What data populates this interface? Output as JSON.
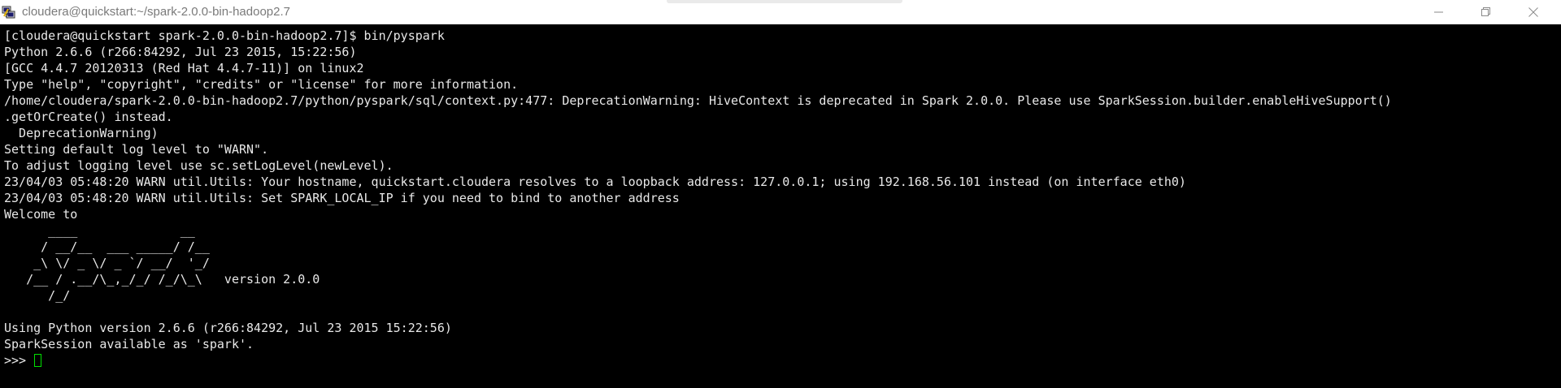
{
  "window": {
    "title": "cloudera@quickstart:~/spark-2.0.0-bin-hadoop2.7",
    "icons": {
      "app": "putty-terminal-icon",
      "minimize": "minimize-icon",
      "restore": "restore-icon",
      "close": "close-icon"
    }
  },
  "terminal": {
    "lines": [
      "[cloudera@quickstart spark-2.0.0-bin-hadoop2.7]$ bin/pyspark",
      "Python 2.6.6 (r266:84292, Jul 23 2015, 15:22:56)",
      "[GCC 4.4.7 20120313 (Red Hat 4.4.7-11)] on linux2",
      "Type \"help\", \"copyright\", \"credits\" or \"license\" for more information.",
      "/home/cloudera/spark-2.0.0-bin-hadoop2.7/python/pyspark/sql/context.py:477: DeprecationWarning: HiveContext is deprecated in Spark 2.0.0. Please use SparkSession.builder.enableHiveSupport()",
      ".getOrCreate() instead.",
      "  DeprecationWarning)",
      "Setting default log level to \"WARN\".",
      "To adjust logging level use sc.setLogLevel(newLevel).",
      "23/04/03 05:48:20 WARN util.Utils: Your hostname, quickstart.cloudera resolves to a loopback address: 127.0.0.1; using 192.168.56.101 instead (on interface eth0)",
      "23/04/03 05:48:20 WARN util.Utils: Set SPARK_LOCAL_IP if you need to bind to another address",
      "Welcome to",
      "      ____              __",
      "     / __/__  ___ _____/ /__",
      "    _\\ \\/ _ \\/ _ `/ __/  '_/",
      "   /__ / .__/\\_,_/_/ /_/\\_\\   version 2.0.0",
      "      /_/",
      "",
      "Using Python version 2.6.6 (r266:84292, Jul 23 2015 15:22:56)",
      "SparkSession available as 'spark'."
    ],
    "prompt": ">>> ",
    "colors": {
      "background": "#000000",
      "foreground": "#e8e8e8",
      "cursor": "#00e000"
    }
  }
}
